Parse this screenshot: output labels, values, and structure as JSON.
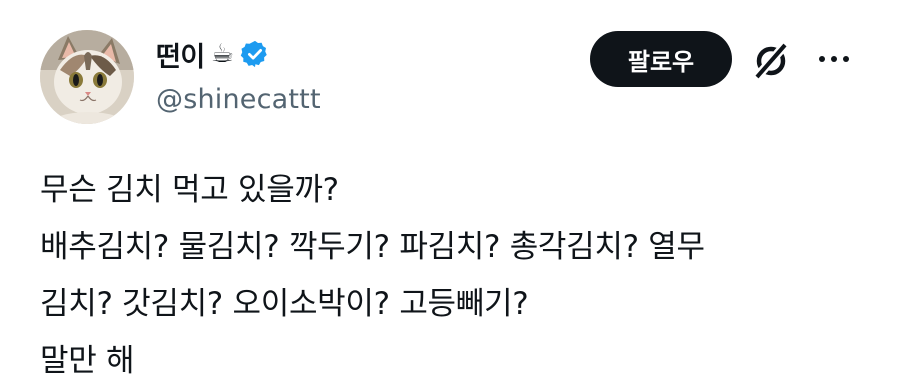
{
  "user": {
    "display_name": "떤이",
    "name_emoji": "☕",
    "handle": "@shinecattt",
    "verified": true,
    "avatar_icon": "cat-avatar"
  },
  "actions": {
    "follow_label": "팔로우",
    "grok_icon": "grok-icon",
    "more_icon": "more-icon"
  },
  "tweet": {
    "lines": [
      "무슨 김치 먹고 있을까?",
      "배추김치? 물김치? 깍두기? 파김치? 총각김치? 열무",
      "김치? 갓김치? 오이소박이? 고등빼기?",
      "말만 해"
    ]
  },
  "colors": {
    "text": "#0f1419",
    "secondary": "#536471",
    "verified_blue": "#1d9bf0",
    "button_bg": "#0f1419"
  }
}
